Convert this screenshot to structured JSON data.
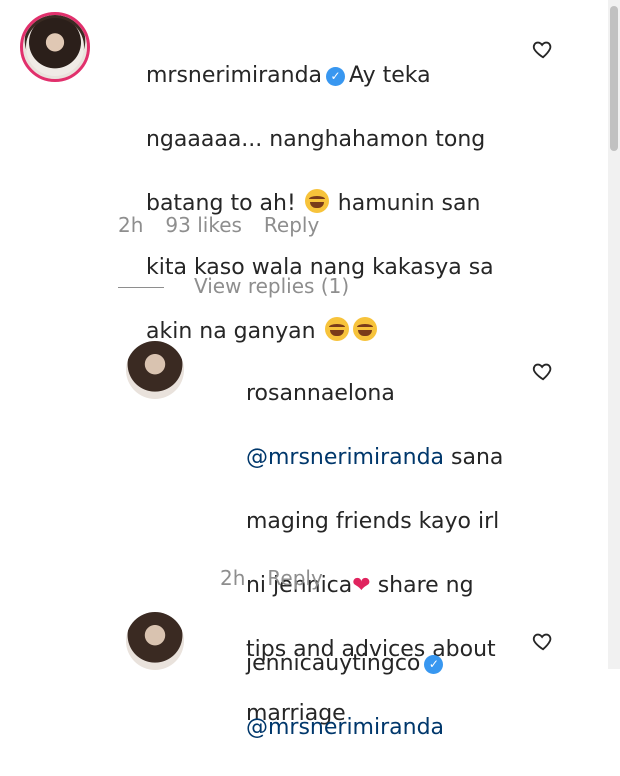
{
  "comments": [
    {
      "username": "mrsnerimiranda",
      "verified": true,
      "text_lines": [
        "Ay teka",
        "ngaaaaa... nanghahamon tong",
        "batang to ah!",
        "hamunin san",
        "kita kaso wala nang kakasya sa",
        "akin na ganyan"
      ],
      "time": "2h",
      "likes": "93 likes",
      "reply_label": "Reply",
      "view_replies": "View replies (1)"
    },
    {
      "username": "rosannaelona",
      "mention": "@mrsnerimiranda",
      "text_lines": [
        "sana",
        "maging friends kayo irl",
        "ni jennica",
        "share ng",
        "tips and advices about",
        "marriage"
      ],
      "time": "2h",
      "reply_label": "Reply"
    },
    {
      "username": "jennicauytingco",
      "verified": true,
      "mention": "@mrsnerimiranda"
    }
  ],
  "colors": {
    "text": "#262626",
    "muted": "#8e8e8e",
    "mention": "#00376b",
    "verified": "#3897f0"
  },
  "icons": {
    "like": "heart-outline-icon",
    "verified": "verified-badge-icon",
    "emoji": "laughing-tears-emoji",
    "heart_emoji": "red-heart-emoji"
  }
}
